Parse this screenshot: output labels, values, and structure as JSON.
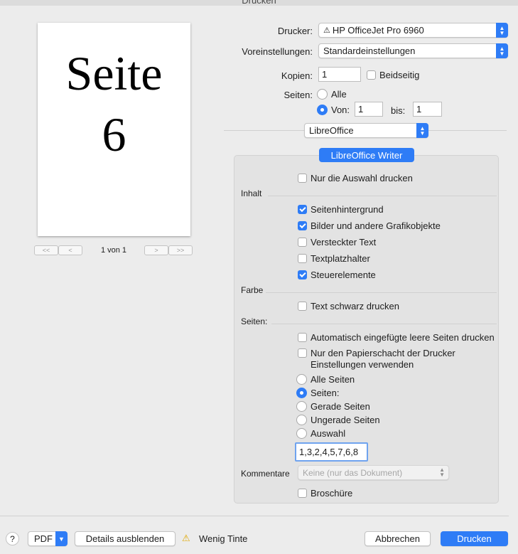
{
  "window": {
    "title": "Drucken"
  },
  "preview": {
    "line1": "Seite",
    "line2": "6",
    "page_indicator": "1 von 1",
    "first": "<<",
    "prev": "<",
    "next": ">",
    "last": ">>"
  },
  "printer": {
    "label": "Drucker:",
    "value": "HP OfficeJet Pro 6960",
    "warning_glyph": "⚠"
  },
  "presets": {
    "label": "Voreinstellungen:",
    "value": "Standardeinstellungen"
  },
  "copies": {
    "label": "Kopien:",
    "value": "1",
    "duplex_label": "Beidseitig",
    "duplex_checked": false
  },
  "pages": {
    "label": "Seiten:",
    "all_label": "Alle",
    "from_label": "Von:",
    "from_value": "1",
    "to_label": "bis:",
    "to_value": "1",
    "selected": "from"
  },
  "app_popup": {
    "value": "LibreOffice"
  },
  "tab": {
    "label": "LibreOffice Writer"
  },
  "options": {
    "only_selection": {
      "label": "Nur die Auswahl drucken",
      "checked": false
    },
    "section_content": "Inhalt",
    "content": [
      {
        "label": "Seitenhintergrund",
        "checked": true
      },
      {
        "label": "Bilder und andere Grafikobjekte",
        "checked": true
      },
      {
        "label": "Versteckter Text",
        "checked": false
      },
      {
        "label": "Textplatzhalter",
        "checked": false
      },
      {
        "label": "Steuerelemente",
        "checked": true
      }
    ],
    "section_color": "Farbe",
    "black_text": {
      "label": "Text schwarz drucken",
      "checked": false
    },
    "section_pages": "Seiten:",
    "auto_blank": {
      "label": "Automatisch eingefügte leere Seiten drucken",
      "checked": false
    },
    "paper_tray": {
      "line1": "Nur den Papierschacht der Drucker",
      "line2": "Einstellungen verwenden",
      "checked": false
    },
    "page_radios": [
      {
        "label": "Alle Seiten",
        "selected": false
      },
      {
        "label": "Seiten:",
        "selected": true
      },
      {
        "label": "Gerade Seiten",
        "selected": false
      },
      {
        "label": "Ungerade Seiten",
        "selected": false
      },
      {
        "label": "Auswahl",
        "selected": false
      }
    ],
    "pages_value": "1,3,2,4,5,7,6,8",
    "comments_label": "Kommentare",
    "comments_value": "Keine (nur das Dokument)",
    "brochure": {
      "label": "Broschüre",
      "checked": false
    }
  },
  "footer": {
    "help": "?",
    "pdf": "PDF",
    "details": "Details ausblenden",
    "warning_glyph": "⚠",
    "low_ink": "Wenig Tinte",
    "cancel": "Abbrechen",
    "print": "Drucken"
  },
  "colors": {
    "accent": "#2e7cf6",
    "warning": "#e0a800"
  }
}
